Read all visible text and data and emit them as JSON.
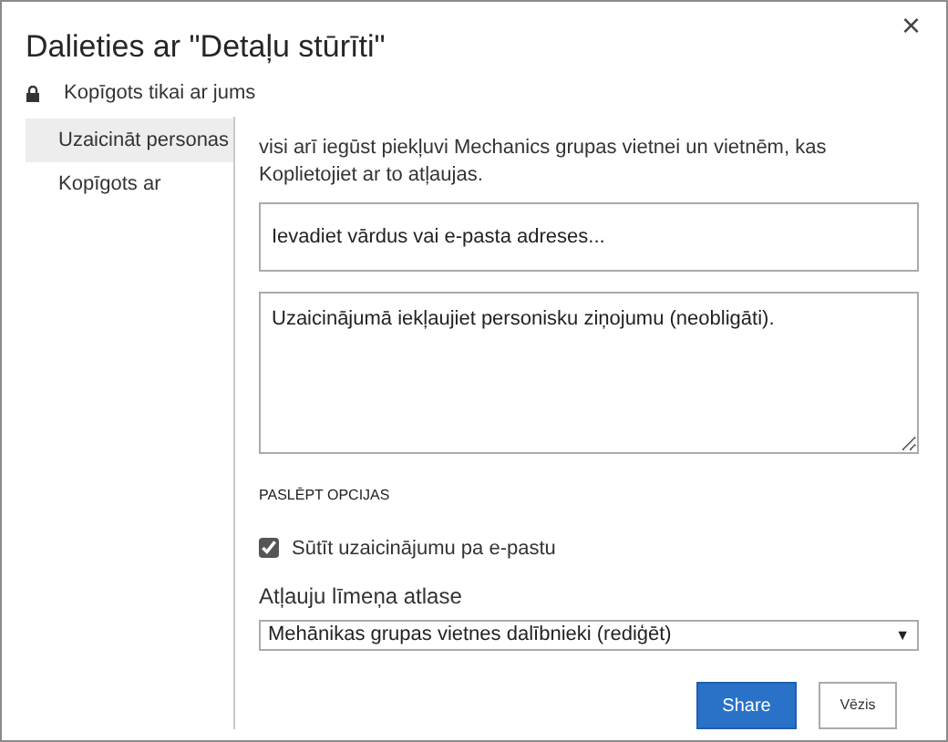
{
  "dialog": {
    "title": "Dalieties ar \"Detaļu stūrīti\"",
    "close": "×",
    "sharing_status": "Kopīgots tikai ar jums"
  },
  "sidebar": {
    "items": [
      {
        "label": "Uzaicināt personas",
        "selected": true
      },
      {
        "label": "Kopīgots ar",
        "selected": false
      }
    ]
  },
  "form": {
    "intro": "visi arī iegūst piekļuvi Mechanics grupas vietnei un vietnēm, kas Koplietojiet ar to atļaujas.",
    "names_field": {
      "placeholder": "Ievadiet vārdus vai e-pasta adreses..."
    },
    "message_field": {
      "placeholder": "Uzaicinājumā iekļaujiet personisku ziņojumu (neobligāti)."
    },
    "options_toggle": "PASLĒPT OPCIJAS",
    "email_invite": {
      "label": "Sūtīt uzaicinājumu pa e-pastu",
      "checked": true
    },
    "permission_label": "Atļauju līmeņa atlase",
    "permission_select": {
      "value": "Mehānikas grupas vietnes dalībnieki (rediģēt)",
      "arrow": "▼"
    }
  },
  "buttons": [
    {
      "label": "Share",
      "kind": "primary"
    },
    {
      "label": "Vēzis",
      "kind": "secondary"
    }
  ]
}
